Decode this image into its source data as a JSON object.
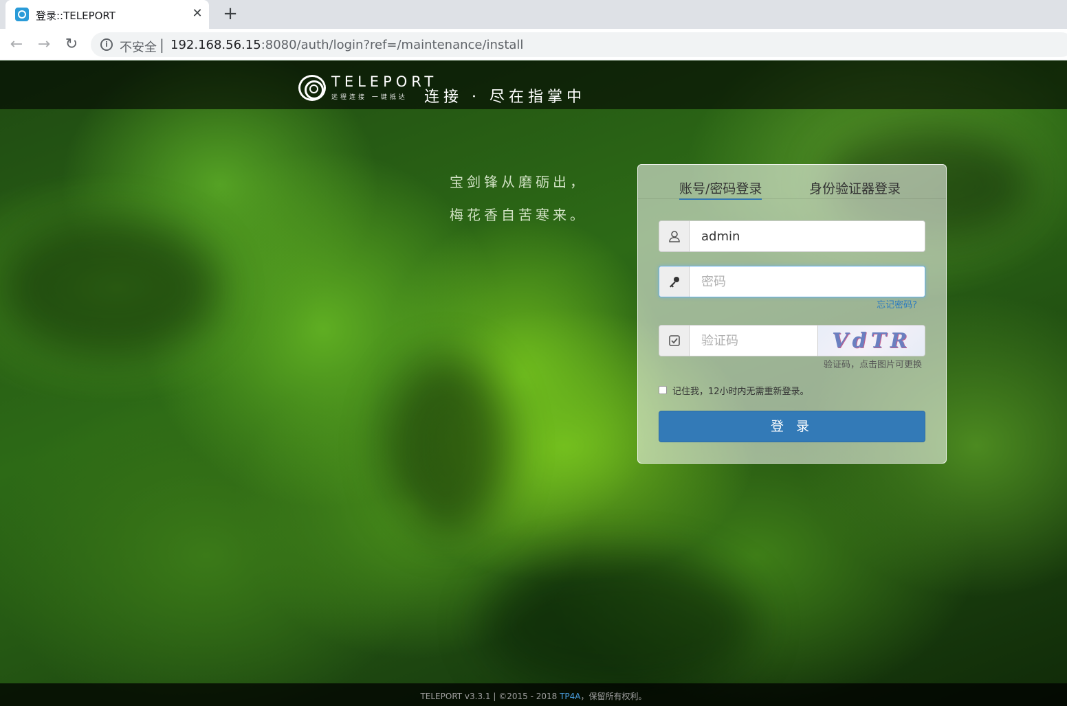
{
  "browser": {
    "tab_title": "登录::TELEPORT",
    "tab_close": "✕",
    "new_tab": "+",
    "back": "←",
    "forward": "→",
    "reload": "↻",
    "security_label": "不安全",
    "separator": "|",
    "url_host": "192.168.56.15",
    "url_rest": ":8080/auth/login?ref=/maintenance/install"
  },
  "header": {
    "logo_name": "TELEPORT",
    "logo_subtitle": "远程连接  一键抵达",
    "slogan": "连接 · 尽在指掌中"
  },
  "poem": {
    "line1": "宝剑锋从磨砺出，",
    "line2": "梅花香自苦寒来。"
  },
  "login": {
    "tab_password": "账号/密码登录",
    "tab_authenticator": "身份验证器登录",
    "username_value": "admin",
    "password_placeholder": "密码",
    "forgot_password": "忘记密码?",
    "captcha_placeholder": "验证码",
    "captcha_image_text": "VdTR",
    "captcha_hint": "验证码，点击图片可更换",
    "remember_label": "记住我，12小时内无需重新登录。",
    "submit_label": "登 录"
  },
  "footer": {
    "text_prefix": "TELEPORT v3.3.1 | ©2015 - 2018 ",
    "link": "TP4A",
    "text_suffix": "，保留所有权利。"
  },
  "colors": {
    "primary": "#337ab7",
    "link": "#2a7ac0",
    "focus_border": "#66afe9"
  },
  "icons": {
    "favicon": "teleport-favicon",
    "info": "info-icon",
    "user": "user-icon",
    "key": "key-icon",
    "checkbox": "check-square-icon"
  }
}
